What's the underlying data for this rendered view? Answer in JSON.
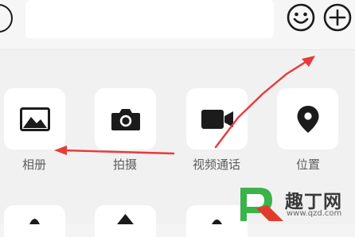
{
  "icons": {
    "voice": "voice-icon",
    "emoji": "emoji-icon",
    "more": "plus-icon"
  },
  "panel": {
    "items": [
      {
        "label": "相册",
        "icon": "picture-icon"
      },
      {
        "label": "拍摄",
        "icon": "camera-icon"
      },
      {
        "label": "视频通话",
        "icon": "video-camera-icon"
      },
      {
        "label": "位置",
        "icon": "location-pin-icon"
      }
    ]
  },
  "annotation": {
    "arrow_color": "#e83a3a"
  },
  "watermark": {
    "name": "趣丁网",
    "url": "www.qzd.com",
    "logo_green": "#3bb24a",
    "logo_red": "#e23b2e"
  }
}
